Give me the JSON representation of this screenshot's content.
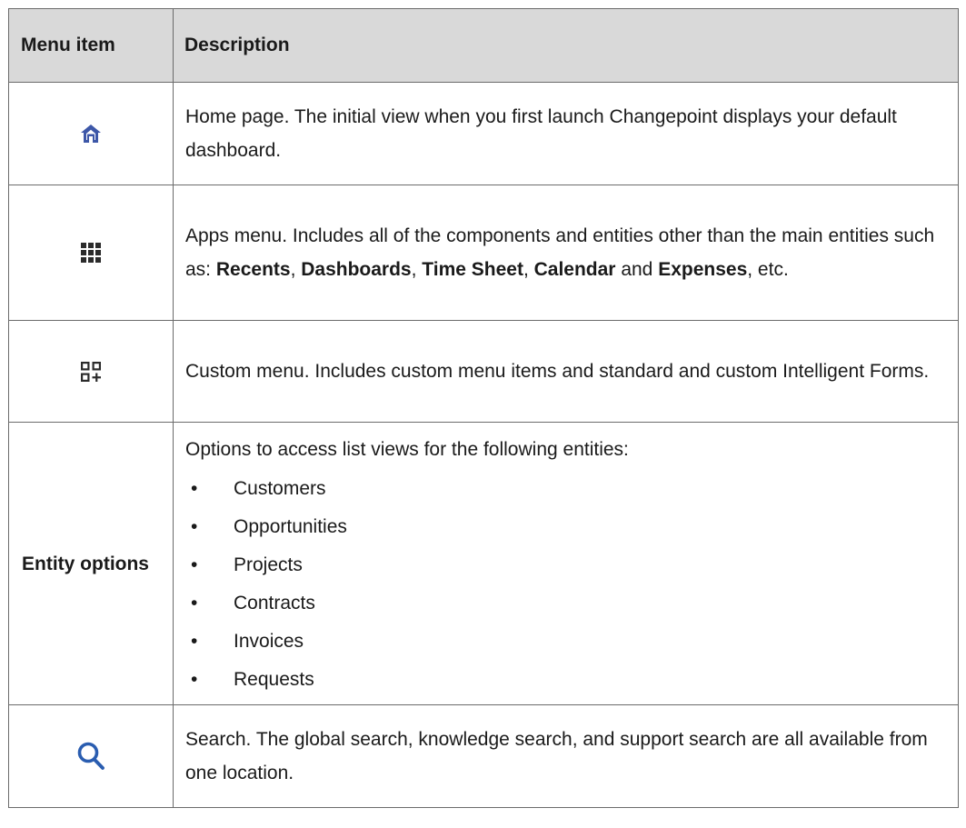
{
  "header": {
    "menu_item": "Menu item",
    "description": "Description"
  },
  "rows": {
    "home": {
      "icon": "home-icon",
      "description": "Home page. The initial view when you first launch Changepoint displays your default dashboard."
    },
    "apps": {
      "icon": "apps-grid-icon",
      "text_1": "Apps menu. Includes all of the components and entities other than the main entities such as: ",
      "b1": "Recents",
      "sep1": ", ",
      "b2": "Dashboards",
      "sep2": ", ",
      "b3": "Time Sheet",
      "sep3": ", ",
      "b4": "Calendar",
      "sep4": " and ",
      "b5": "Expenses",
      "end": ", etc."
    },
    "custom": {
      "icon": "custom-menu-icon",
      "description": "Custom menu. Includes custom menu items and standard and custom Intelligent Forms."
    },
    "entity": {
      "label": "Entity options",
      "intro": "Options to access list views for the following entities:",
      "items": [
        "Customers",
        "Opportunities",
        "Projects",
        "Contracts",
        "Invoices",
        "Requests"
      ]
    },
    "search": {
      "icon": "search-icon",
      "description": "Search. The global search, knowledge search, and support search are all available from one location."
    }
  },
  "colors": {
    "header_bg": "#d9d9d9",
    "border": "#6b6b6b",
    "home_icon": "#3d57a8",
    "search_icon": "#2a5db0",
    "dark_icon": "#2b2b2b"
  }
}
